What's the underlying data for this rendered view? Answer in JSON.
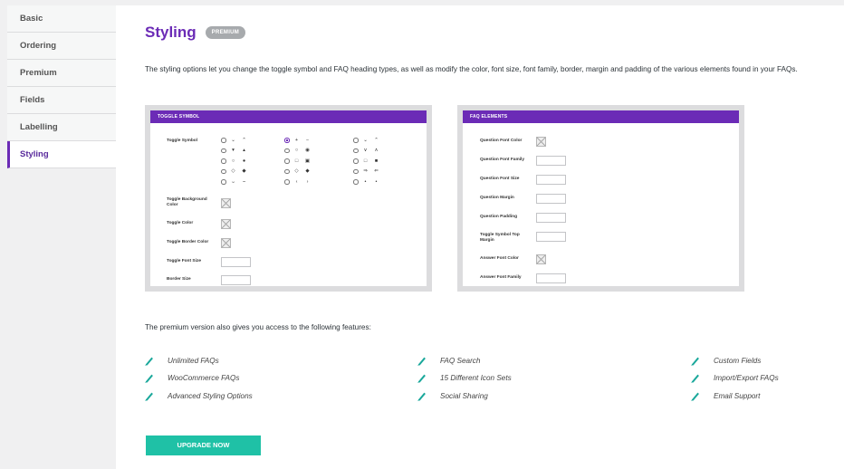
{
  "sidebar": {
    "items": [
      {
        "label": "Basic"
      },
      {
        "label": "Ordering"
      },
      {
        "label": "Premium"
      },
      {
        "label": "Fields"
      },
      {
        "label": "Labelling"
      },
      {
        "label": "Styling",
        "active": true
      }
    ]
  },
  "header": {
    "title": "Styling",
    "badge": "PREMIUM"
  },
  "intro": "The styling options let you change the toggle symbol and FAQ heading types, as well as modify the color, font size, font family, border, margin and padding of the various elements found in your FAQs.",
  "toggle_card": {
    "heading": "TOGGLE SYMBOL",
    "symbol_label": "Toggle Symbol",
    "symbol_columns": [
      [
        [
          "⌄",
          "⌃"
        ],
        [
          "▾",
          "▴"
        ],
        [
          "○",
          "●"
        ],
        [
          "◇",
          "◆"
        ],
        [
          "⌣",
          "⌢"
        ]
      ],
      [
        [
          "+",
          "−"
        ],
        [
          "○",
          "◉"
        ],
        [
          "□",
          "▣"
        ],
        [
          "◇",
          "◆"
        ],
        [
          "‹",
          "›"
        ]
      ],
      [
        [
          "⌄",
          "⌃"
        ],
        [
          "∨",
          "∧"
        ],
        [
          "□",
          "■"
        ],
        [
          "⇒",
          "⇐"
        ],
        [
          "•",
          "•"
        ]
      ]
    ],
    "fields": [
      {
        "label": "Toggle Background Color",
        "type": "color"
      },
      {
        "label": "Toggle Color",
        "type": "color"
      },
      {
        "label": "Toggle Border Color",
        "type": "color"
      },
      {
        "label": "Toggle Font Size",
        "type": "text"
      },
      {
        "label": "Border Size",
        "type": "text"
      }
    ]
  },
  "faq_card": {
    "heading": "FAQ ELEMENTS",
    "fields": [
      {
        "label": "Question Font Color",
        "type": "color"
      },
      {
        "label": "Question Font Family",
        "type": "text"
      },
      {
        "label": "Question Font Size",
        "type": "text"
      },
      {
        "label": "Question Margin",
        "type": "text"
      },
      {
        "label": "Question Padding",
        "type": "text"
      },
      {
        "label": "Toggle Symbol Top Margin",
        "type": "text"
      },
      {
        "label": "Answer Font Color",
        "type": "color"
      },
      {
        "label": "Answer Font Family",
        "type": "text"
      }
    ]
  },
  "features": {
    "intro": "The premium version also gives you access to the following features:",
    "col1": [
      "Unlimited FAQs",
      "WooCommerce FAQs",
      "Advanced Styling Options"
    ],
    "col2": [
      "FAQ Search",
      "15 Different Icon Sets",
      "Social Sharing"
    ],
    "col3": [
      "Custom Fields",
      "Import/Export FAQs",
      "Email Support"
    ]
  },
  "upgrade_button": "UPGRADE NOW",
  "colors": {
    "accent": "#6b2bb6",
    "button": "#1fc1a6",
    "check": "#1aa89b"
  }
}
